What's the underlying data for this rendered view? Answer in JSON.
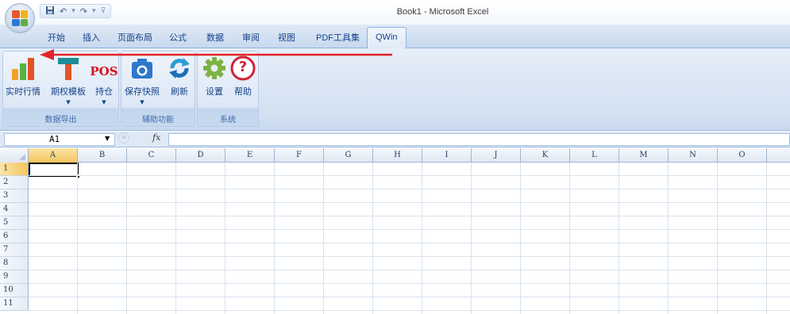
{
  "window": {
    "title": "Book1 - Microsoft Excel"
  },
  "quick_access": {
    "save_icon": "save-icon",
    "undo_icon": "undo-icon",
    "redo_icon": "redo-icon"
  },
  "tabs": [
    {
      "label": "开始"
    },
    {
      "label": "插入"
    },
    {
      "label": "页面布局"
    },
    {
      "label": "公式"
    },
    {
      "label": "数据"
    },
    {
      "label": "审阅"
    },
    {
      "label": "视图"
    },
    {
      "label": "PDF工具集"
    },
    {
      "label": "QWin"
    }
  ],
  "active_tab": "QWin",
  "ribbon": {
    "groups": [
      {
        "label": "数据导出",
        "buttons": [
          {
            "label": "实时行情",
            "icon": "bar-chart-icon"
          },
          {
            "label": "期权模板",
            "icon": "t-icon"
          },
          {
            "label": "持仓",
            "icon_text": "POS"
          }
        ]
      },
      {
        "label": "辅助功能",
        "buttons": [
          {
            "label": "保存快照",
            "icon": "camera-icon"
          },
          {
            "label": "刷新",
            "icon": "refresh-icon"
          }
        ]
      },
      {
        "label": "系统",
        "buttons": [
          {
            "label": "设置",
            "icon": "gear-icon"
          },
          {
            "label": "帮助",
            "icon": "help-icon",
            "icon_text": "?"
          }
        ]
      }
    ]
  },
  "formula_bar": {
    "name_box": "A1",
    "fx_label": "fx",
    "formula": ""
  },
  "sheet": {
    "columns": [
      "A",
      "B",
      "C",
      "D",
      "E",
      "F",
      "G",
      "H",
      "I",
      "J",
      "K",
      "L",
      "M",
      "N",
      "O"
    ],
    "rows": [
      "1",
      "2",
      "3",
      "4",
      "5",
      "6",
      "7",
      "8",
      "9",
      "10",
      "11"
    ],
    "active_cell": "A1"
  },
  "colors": {
    "annotation_arrow": "#e3242b",
    "accent": "#15428b"
  }
}
